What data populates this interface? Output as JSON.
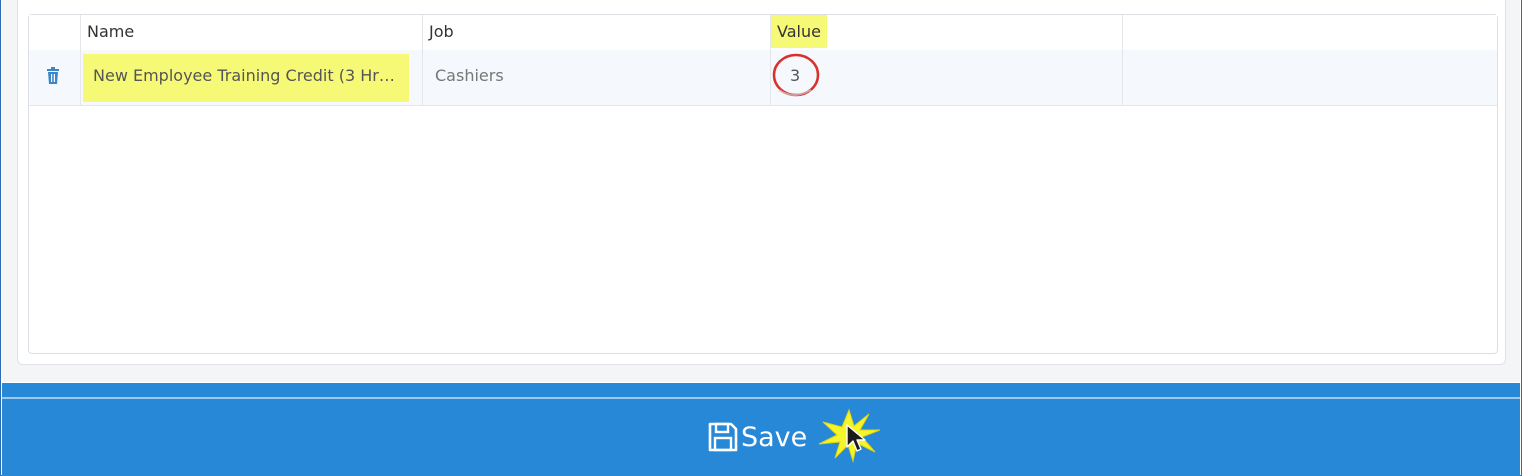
{
  "grid": {
    "columns": [
      {
        "key": "actions",
        "label": ""
      },
      {
        "key": "name",
        "label": "Name"
      },
      {
        "key": "job",
        "label": "Job"
      },
      {
        "key": "value",
        "label": "Value"
      },
      {
        "key": "extra",
        "label": ""
      }
    ],
    "rows": [
      {
        "delete_icon": "trash-icon",
        "name": "New Employee Training Credit (3 Hrs...",
        "job": "Cashiers",
        "value": "3"
      }
    ]
  },
  "footer": {
    "save_label": "Save",
    "save_icon": "floppy-disk-icon"
  },
  "colors": {
    "highlight": "#f6f976",
    "footer_bg": "#2888d8",
    "annotation_circle": "#d9302c",
    "trash_icon": "#3a86c8"
  }
}
